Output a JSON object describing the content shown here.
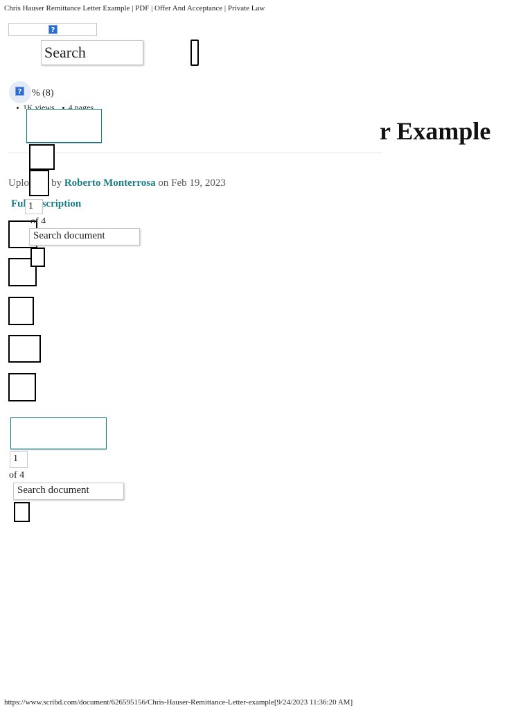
{
  "page": {
    "print_title": "Chris Hauser Remittance Letter Example | PDF | Offer And Acceptance | Private Law",
    "footer_url": "https://www.scribd.com/document/626595156/Chris-Hauser-Remittance-Letter-example[9/24/2023 11:36:20 AM]"
  },
  "header": {
    "help_icon_glyph": "?",
    "search_placeholder": "Search"
  },
  "document": {
    "title_visible": "r Example",
    "rating_text": "% (8)",
    "views": "1K views",
    "pages": "4 pages",
    "uploaded_prefix": "Uploaded by",
    "author": "Roberto Monterrosa",
    "uploaded_on": "on Feb 19, 2023",
    "full_description": "Full description"
  },
  "viewer_top": {
    "page_number": "1",
    "of_pages": "of 4",
    "search_placeholder": "Search document"
  },
  "viewer_bottom": {
    "page_number": "1",
    "of_pages": "of 4",
    "search_placeholder": "Search document"
  },
  "colors": {
    "accent_teal": "#1b7d84",
    "help_icon_blue": "#2a6bd1",
    "rating_bg": "#e4ebf6"
  }
}
